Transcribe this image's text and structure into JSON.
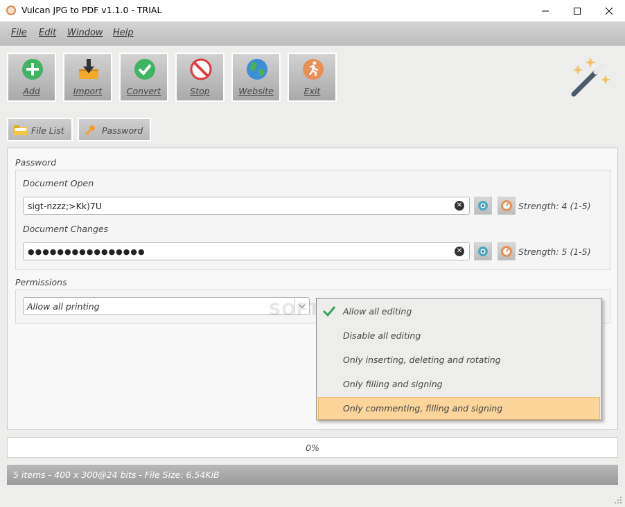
{
  "window": {
    "title": "Vulcan JPG to PDF v1.1.0 - TRIAL"
  },
  "menu": [
    "File",
    "Edit",
    "Window",
    "Help"
  ],
  "toolbar": {
    "add": "Add",
    "import": "Import",
    "convert": "Convert",
    "stop": "Stop",
    "website": "Website",
    "exit": "Exit"
  },
  "tabs": {
    "file_list": "File List",
    "password": "Password"
  },
  "password_section": {
    "title": "Password",
    "document_open_label": "Document Open",
    "document_open_value": "sigt-nzzz;>Kk)7U",
    "document_open_strength": "Strength: 4 (1-5)",
    "document_changes_label": "Document Changes",
    "document_changes_value": "●●●●●●●●●●●●●●●●",
    "document_changes_strength": "Strength: 5 (1-5)"
  },
  "permissions": {
    "title": "Permissions",
    "printing_selected": "Allow all printing",
    "editing_options": [
      "Allow all editing",
      "Disable all editing",
      "Only inserting, deleting and rotating",
      "Only filling and signing",
      "Only commenting, filling and signing"
    ],
    "checked_index": 0,
    "highlighted_index": 4
  },
  "progress": {
    "text": "0%",
    "value": 0
  },
  "status": {
    "text": "5 items - 400 x 300@24 bits - File Size: 6.54KiB"
  },
  "colors": {
    "accent_orange": "#fbd59a",
    "check_green": "#3aa35a"
  }
}
